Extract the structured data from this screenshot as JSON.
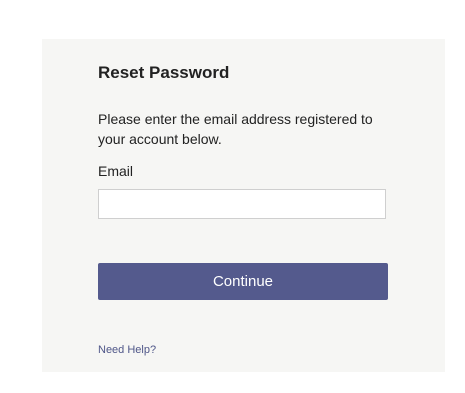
{
  "form": {
    "title": "Reset Password",
    "description": "Please enter the email address registered to your account below.",
    "email_label": "Email",
    "email_value": "",
    "email_placeholder": "",
    "continue_label": "Continue",
    "help_link": "Need Help?"
  },
  "colors": {
    "panel_background": "#f6f6f4",
    "button_background": "#545a8d",
    "button_text": "#ffffff",
    "link": "#4f5688"
  }
}
